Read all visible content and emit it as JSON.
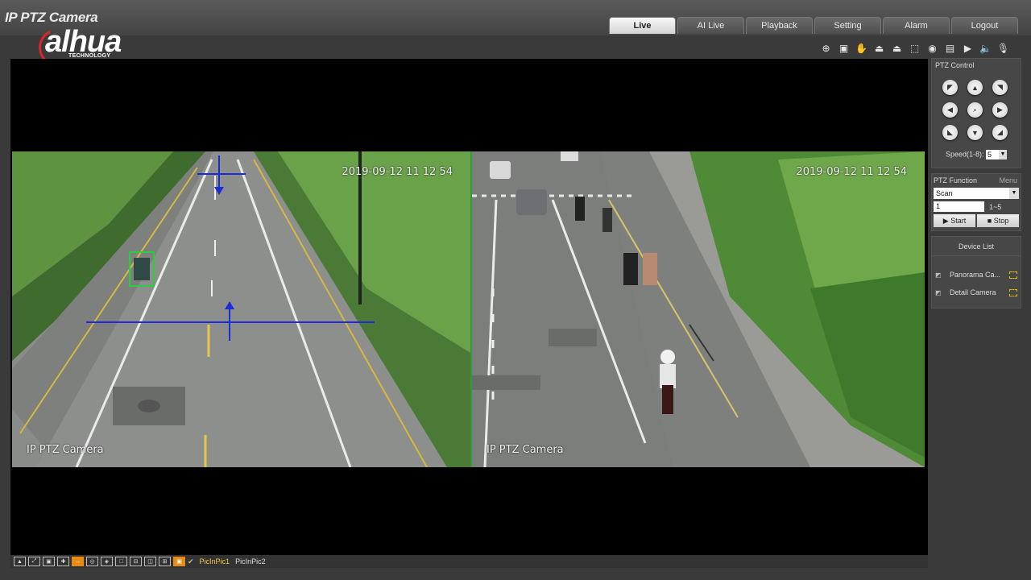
{
  "app": {
    "title": "IP PTZ Camera",
    "logo_text": "alhua",
    "logo_sub": "TECHNOLOGY"
  },
  "tabs": [
    {
      "label": "Live",
      "active": true
    },
    {
      "label": "AI Live",
      "active": false
    },
    {
      "label": "Playback",
      "active": false
    },
    {
      "label": "Setting",
      "active": false
    },
    {
      "label": "Alarm",
      "active": false
    },
    {
      "label": "Logout",
      "active": false
    }
  ],
  "toolbar_icons": [
    "ptz-link-icon",
    "region-focus-icon",
    "hand-icon",
    "wiper-icon",
    "light-icon",
    "zoom-area-icon",
    "snapshot-icon",
    "triple-snapshot-icon",
    "record-icon",
    "audio-icon",
    "microphone-icon"
  ],
  "cameras": {
    "left": {
      "timestamp": "2019-09-12 11 12 54",
      "label": "IP PTZ Camera"
    },
    "right": {
      "timestamp": "2019-09-12 11 12 54",
      "label": "IP PTZ Camera"
    }
  },
  "ptz_control": {
    "title": "PTZ Control",
    "speed_label": "Speed(1-8):",
    "speed_value": "5"
  },
  "ptz_function": {
    "title": "PTZ Function",
    "menu_label": "Menu",
    "selected": "Scan",
    "number_value": "1",
    "range_label": "1~5",
    "start_label": "Start",
    "stop_label": "Stop"
  },
  "device_list": {
    "title": "Device List",
    "items": [
      "Panorama Ca...",
      "Detail Camera"
    ]
  },
  "bottom_bar": {
    "pip1": "PicInPic1",
    "pip2": "PicInPic2"
  },
  "colors": {
    "accent_orange": "#e98b12",
    "active_tab": "#e8e8e8",
    "green_box": "#2ecc40",
    "tripwire_blue": "#1d2bd8"
  }
}
